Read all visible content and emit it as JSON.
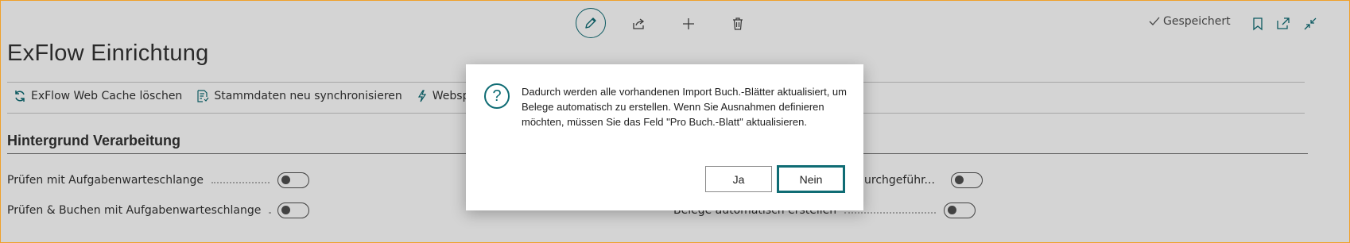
{
  "header": {
    "saved_label": "Gespeichert",
    "icons": [
      "edit-icon",
      "share-icon",
      "add-icon",
      "delete-icon",
      "check-icon",
      "bookmark-icon",
      "popout-icon",
      "collapse-icon"
    ]
  },
  "page": {
    "title": "ExFlow Einrichtung"
  },
  "actions": [
    {
      "label": "ExFlow Web Cache löschen",
      "icon": "refresh-icon"
    },
    {
      "label": "Stammdaten neu synchronisieren",
      "icon": "document-sync-icon"
    },
    {
      "label": "Webspalten bea",
      "icon": "lightning-icon"
    }
  ],
  "section": {
    "title": "Hintergrund Verarbeitung",
    "fields": [
      {
        "label": "Prüfen mit Aufgabenwarteschlange",
        "value": false
      },
      {
        "label": "Prüfen & Buchen mit Aufgabenwarteschlange",
        "value": false
      },
      {
        "label": "urchgeführ...",
        "value": false
      },
      {
        "label": "Belege automatisch erstellen",
        "value": false
      }
    ]
  },
  "dialog": {
    "message": "Dadurch werden alle vorhandenen Import Buch.-Blätter aktualisiert, um Belege automatisch zu erstellen. Wenn Sie Ausnahmen definieren möchten, müssen Sie das Feld \"Pro Buch.-Blatt\" aktualisieren.",
    "yes_label": "Ja",
    "no_label": "Nein",
    "icon": "question-icon"
  },
  "colors": {
    "accent": "#0f6c74",
    "frame_border": "#f0a02a",
    "overlay": "rgba(0,0,0,0.17)"
  }
}
